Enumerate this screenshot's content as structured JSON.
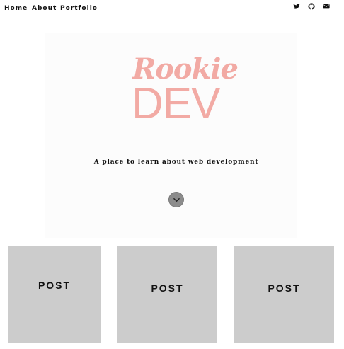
{
  "nav": {
    "items": [
      {
        "label": "Home"
      },
      {
        "label": "About"
      },
      {
        "label": "Portfolio"
      }
    ]
  },
  "social": {
    "icons": [
      "twitter-icon",
      "github-icon",
      "envelope-icon"
    ]
  },
  "hero": {
    "logo_word1": "Rookie",
    "logo_word2": "DEV",
    "tagline": "A place to learn about web development",
    "logo_color": "#f2aaa4"
  },
  "posts": [
    {
      "label": "POST"
    },
    {
      "label": "POST"
    },
    {
      "label": "POST"
    }
  ],
  "colors": {
    "card_bg": "#cccccc",
    "scroll_button": "#8c8c8c"
  }
}
